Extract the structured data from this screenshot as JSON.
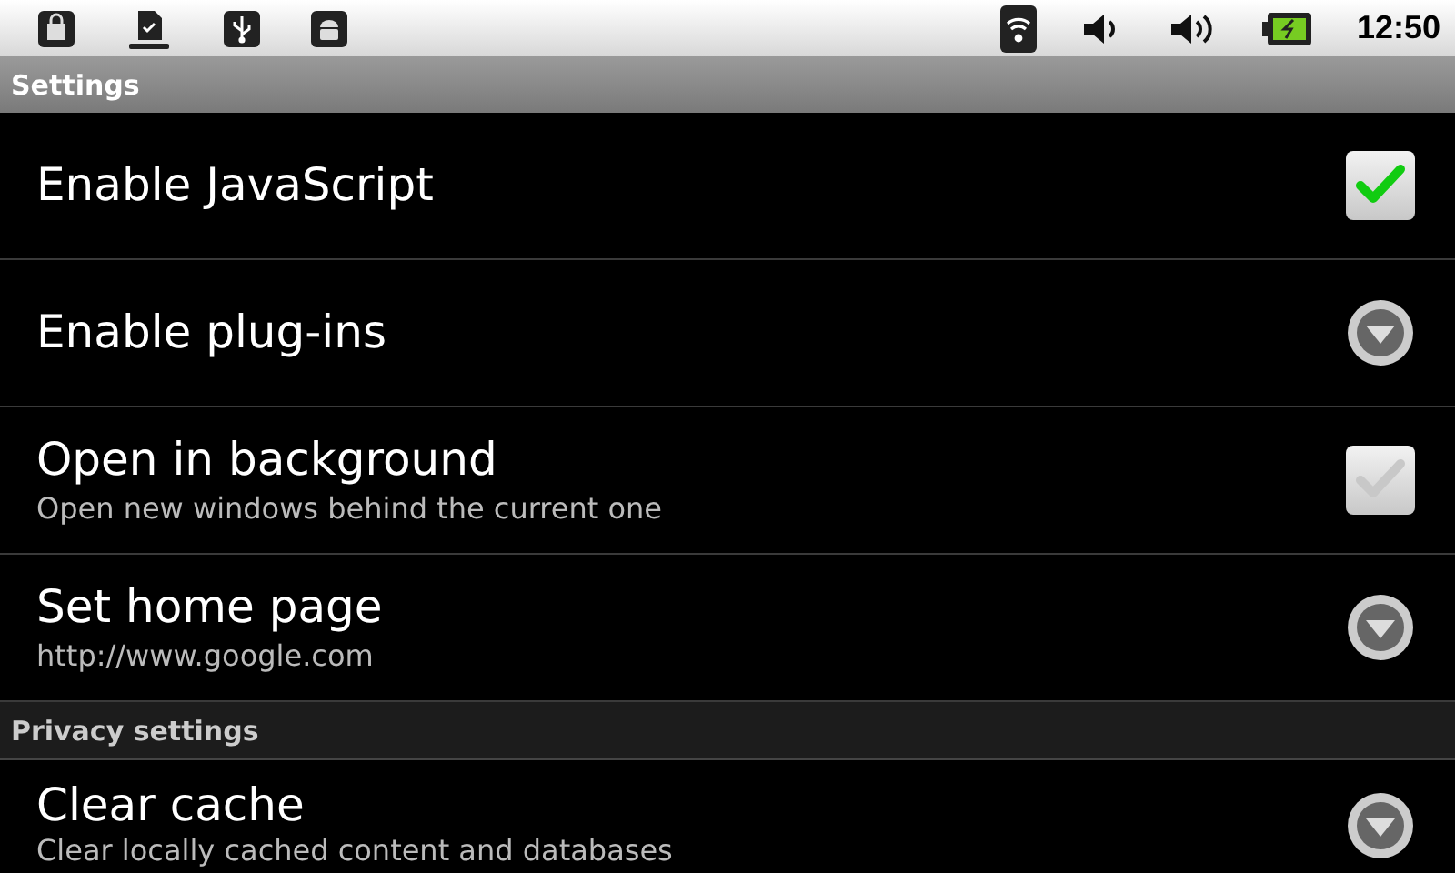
{
  "status_bar": {
    "time": "12:50"
  },
  "title": "Settings",
  "sections": [
    {
      "items": [
        {
          "kind": "checkbox",
          "title": "Enable JavaScript",
          "checked": true
        },
        {
          "kind": "list",
          "title": "Enable plug-ins"
        },
        {
          "kind": "checkbox",
          "title": "Open in background",
          "summary": "Open new windows behind the current one",
          "checked": false
        },
        {
          "kind": "list",
          "title": "Set home page",
          "summary": "http://www.google.com"
        }
      ]
    },
    {
      "header": "Privacy settings",
      "items": [
        {
          "kind": "list",
          "title": "Clear cache",
          "summary": "Clear locally cached content and databases"
        }
      ]
    }
  ]
}
